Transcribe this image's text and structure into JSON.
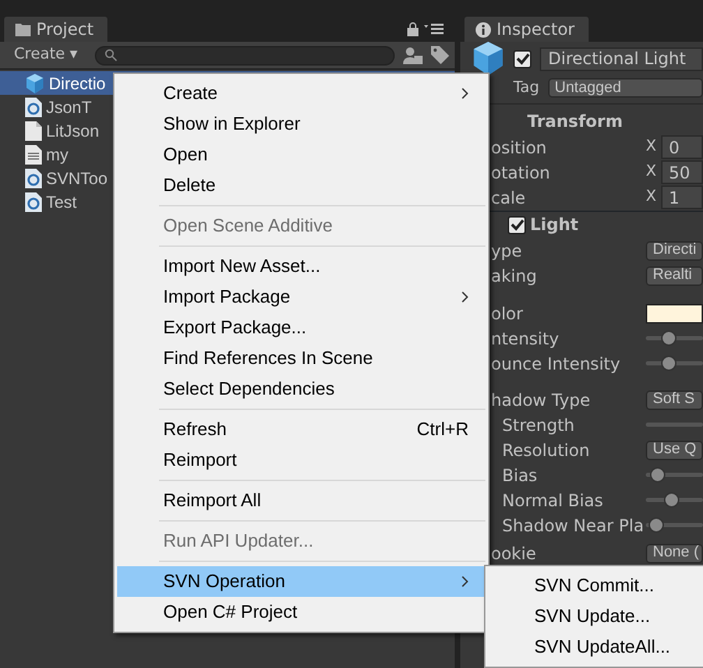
{
  "project": {
    "tab": "Project",
    "create_button": "Create ▾",
    "items": [
      {
        "label": "Directio",
        "kind": "cube",
        "selected": true
      },
      {
        "label": "JsonT",
        "kind": "script",
        "selected": false
      },
      {
        "label": "LitJson",
        "kind": "file",
        "selected": false
      },
      {
        "label": "my",
        "kind": "text",
        "selected": false
      },
      {
        "label": "SVNToo",
        "kind": "script",
        "selected": false
      },
      {
        "label": "Test",
        "kind": "script",
        "selected": false
      }
    ]
  },
  "inspector": {
    "tab": "Inspector",
    "object_name": "Directional Light",
    "active": true,
    "tag_label": "Tag",
    "tag": "Untagged",
    "rows": [
      {
        "kind": "header",
        "label": "Transform"
      },
      {
        "kind": "vector",
        "label": "osition",
        "axis": "X",
        "value": "0"
      },
      {
        "kind": "vector",
        "label": "otation",
        "axis": "X",
        "value": "50"
      },
      {
        "kind": "vector",
        "label": "cale",
        "axis": "X",
        "value": "1"
      },
      {
        "kind": "check_header",
        "label": "Light",
        "checked": true
      },
      {
        "kind": "dropdown",
        "label": "ype",
        "value": "Directi"
      },
      {
        "kind": "dropdown",
        "label": "aking",
        "value": "Realti"
      },
      {
        "kind": "color",
        "label": "olor",
        "color": "#fff4dc"
      },
      {
        "kind": "slider",
        "label": "ntensity",
        "level": 0.38
      },
      {
        "kind": "slider",
        "label": "ounce Intensity",
        "level": 0.38
      },
      {
        "kind": "dropdown",
        "label": "hadow Type",
        "value": "Soft S"
      },
      {
        "kind": "track",
        "label": "Strength",
        "sub": true
      },
      {
        "kind": "dropdown",
        "label": "Resolution",
        "value": "Use Q",
        "sub": true
      },
      {
        "kind": "slider",
        "label": "Bias",
        "level": 0.1,
        "sub": true
      },
      {
        "kind": "slider",
        "label": "Normal Bias",
        "level": 0.45,
        "sub": true
      },
      {
        "kind": "slider",
        "label": "Shadow Near Pla",
        "level": 0.08,
        "sub": true
      },
      {
        "kind": "dropdown",
        "label": "ookie",
        "value": "None ("
      }
    ]
  },
  "context_menu": {
    "items": [
      {
        "kind": "item",
        "label": "Create",
        "submenu": true
      },
      {
        "kind": "item",
        "label": "Show in Explorer"
      },
      {
        "kind": "item",
        "label": "Open"
      },
      {
        "kind": "item",
        "label": "Delete"
      },
      {
        "kind": "separator"
      },
      {
        "kind": "item",
        "label": "Open Scene Additive",
        "disabled": true
      },
      {
        "kind": "separator"
      },
      {
        "kind": "item",
        "label": "Import New Asset..."
      },
      {
        "kind": "item",
        "label": "Import Package",
        "submenu": true
      },
      {
        "kind": "item",
        "label": "Export Package..."
      },
      {
        "kind": "item",
        "label": "Find References In Scene"
      },
      {
        "kind": "item",
        "label": "Select Dependencies"
      },
      {
        "kind": "separator"
      },
      {
        "kind": "item",
        "label": "Refresh",
        "shortcut": "Ctrl+R"
      },
      {
        "kind": "item",
        "label": "Reimport"
      },
      {
        "kind": "separator"
      },
      {
        "kind": "item",
        "label": "Reimport All"
      },
      {
        "kind": "separator"
      },
      {
        "kind": "item",
        "label": "Run API Updater...",
        "disabled": true
      },
      {
        "kind": "separator"
      },
      {
        "kind": "item",
        "label": "SVN Operation",
        "submenu": true,
        "selected": true
      },
      {
        "kind": "item",
        "label": "Open C# Project"
      }
    ],
    "submenu": [
      "SVN Commit...",
      "SVN Update...",
      "SVN UpdateAll..."
    ]
  }
}
